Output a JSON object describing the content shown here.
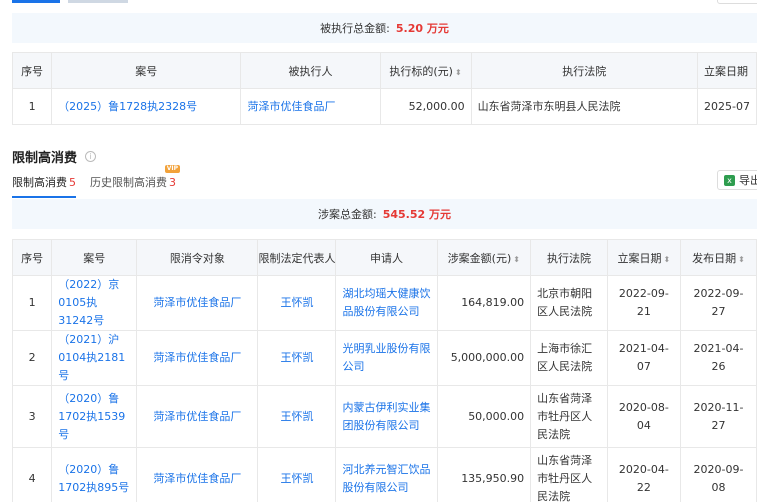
{
  "exec": {
    "summary_label": "被执行总金额:",
    "summary_value": "5.20 万元",
    "headers": [
      "序号",
      "案号",
      "被执行人",
      "执行标的(元)",
      "执行法院",
      "立案日期"
    ],
    "rows": [
      {
        "no": "1",
        "case": "（2025）鲁1728执2328号",
        "party": "菏泽市优佳食品厂",
        "amount": "52,000.00",
        "court": "山东省菏泽市东明县人民法院",
        "date": "2025-07"
      }
    ]
  },
  "consumption": {
    "section_title": "限制高消费",
    "tabs": [
      {
        "label": "限制高消费",
        "count": "5"
      },
      {
        "label": "历史限制高消费",
        "count": "3",
        "badge": "VIP"
      }
    ],
    "export_label": "导出",
    "summary_label": "涉案总金额:",
    "summary_value": "545.52 万元",
    "headers": [
      "序号",
      "案号",
      "限消令对象",
      "限制法定代表人",
      "申请人",
      "涉案金额(元)",
      "执行法院",
      "立案日期",
      "发布日期"
    ],
    "rows": [
      {
        "no": "1",
        "case": "（2022）京0105执31242号",
        "target": "菏泽市优佳食品厂",
        "rep": "王怀凯",
        "applicant": "湖北均瑶大健康饮品股份有限公司",
        "amount": "164,819.00",
        "court": "北京市朝阳区人民法院",
        "filed": "2022-09-21",
        "published": "2022-09-27"
      },
      {
        "no": "2",
        "case": "（2021）沪0104执2181号",
        "target": "菏泽市优佳食品厂",
        "rep": "王怀凯",
        "applicant": "光明乳业股份有限公司",
        "amount": "5,000,000.00",
        "court": "上海市徐汇区人民法院",
        "filed": "2021-04-07",
        "published": "2021-04-26"
      },
      {
        "no": "3",
        "case": "（2020）鲁1702执1539号",
        "target": "菏泽市优佳食品厂",
        "rep": "王怀凯",
        "applicant": "内蒙古伊利实业集团股份有限公司",
        "amount": "50,000.00",
        "court": "山东省菏泽市牡丹区人民法院",
        "filed": "2020-08-04",
        "published": "2020-11-27"
      },
      {
        "no": "4",
        "case": "（2020）鲁1702执895号",
        "target": "菏泽市优佳食品厂",
        "rep": "王怀凯",
        "applicant": "河北养元智汇饮品股份有限公司",
        "amount": "135,950.90",
        "court": "山东省菏泽市牡丹区人民法院",
        "filed": "2020-04-22",
        "published": "2020-09-08"
      }
    ]
  },
  "colors": {
    "link": "#1a73e8",
    "accent_red": "#e53935",
    "summary_bg": "#f3f8fd",
    "header_bg": "#f5f7fa"
  }
}
